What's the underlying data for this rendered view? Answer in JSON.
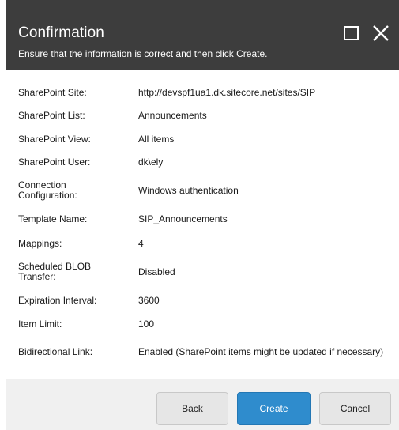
{
  "dialog": {
    "title": "Confirmation",
    "subtitle": "Ensure that the information is correct and then click Create."
  },
  "rows": [
    {
      "label": "SharePoint Site:",
      "value": "http://devspf1ua1.dk.sitecore.net/sites/SIP"
    },
    {
      "label": "SharePoint List:",
      "value": "Announcements"
    },
    {
      "label": "SharePoint View:",
      "value": "All items"
    },
    {
      "label": "SharePoint User:",
      "value": "dk\\ely"
    },
    {
      "label": "Connection Configuration:",
      "value": "Windows authentication"
    },
    {
      "label": "Template Name:",
      "value": "SIP_Announcements"
    },
    {
      "label": "Mappings:",
      "value": "4"
    },
    {
      "label": "Scheduled BLOB Transfer:",
      "value": "Disabled"
    },
    {
      "label": "Expiration Interval:",
      "value": "3600"
    },
    {
      "label": "Item Limit:",
      "value": "100"
    },
    {
      "label": "Bidirectional Link:",
      "value": "Enabled (SharePoint items might be updated if necessary)"
    }
  ],
  "buttons": {
    "back": "Back",
    "create": "Create",
    "cancel": "Cancel"
  },
  "colors": {
    "titlebar": "#3d3d3d",
    "primary": "#2f8ccd",
    "footer": "#f0f0f0"
  },
  "icons": {
    "maximize": "maximize-icon",
    "close": "close-icon"
  }
}
